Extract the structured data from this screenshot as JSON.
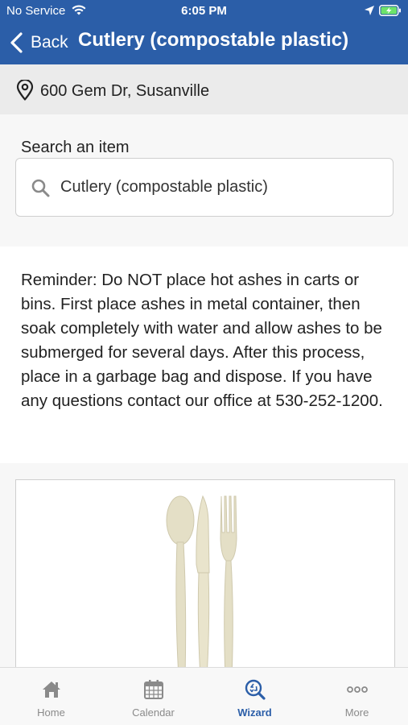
{
  "status_bar": {
    "carrier": "No Service",
    "time": "6:05 PM"
  },
  "nav": {
    "back_label": "Back",
    "title": "Cutlery (compostable plastic)"
  },
  "address": {
    "text": "600 Gem Dr, Susanville"
  },
  "search": {
    "label": "Search an item",
    "value": "Cutlery (compostable plastic)",
    "icon": "search-icon"
  },
  "reminder": {
    "text": "Reminder: Do NOT place hot ashes in carts or bins. First place ashes in metal container, then soak completely with water and allow ashes to be submerged for several days. After this process, place in a garbage bag and dispose. If you have any questions contact our office at 530-252-1200."
  },
  "item_image": {
    "subject": "compostable plastic spoon, knife and fork"
  },
  "tabs": [
    {
      "label": "Home",
      "icon": "home-icon",
      "active": false
    },
    {
      "label": "Calendar",
      "icon": "calendar-icon",
      "active": false
    },
    {
      "label": "Wizard",
      "icon": "wizard-icon",
      "active": true
    },
    {
      "label": "More",
      "icon": "more-icon",
      "active": false
    }
  ],
  "colors": {
    "header": "#2b5ea8",
    "active_tab": "#2b5ea8",
    "inactive_tab": "#8a8a8a",
    "address_bg": "#ebebeb"
  }
}
